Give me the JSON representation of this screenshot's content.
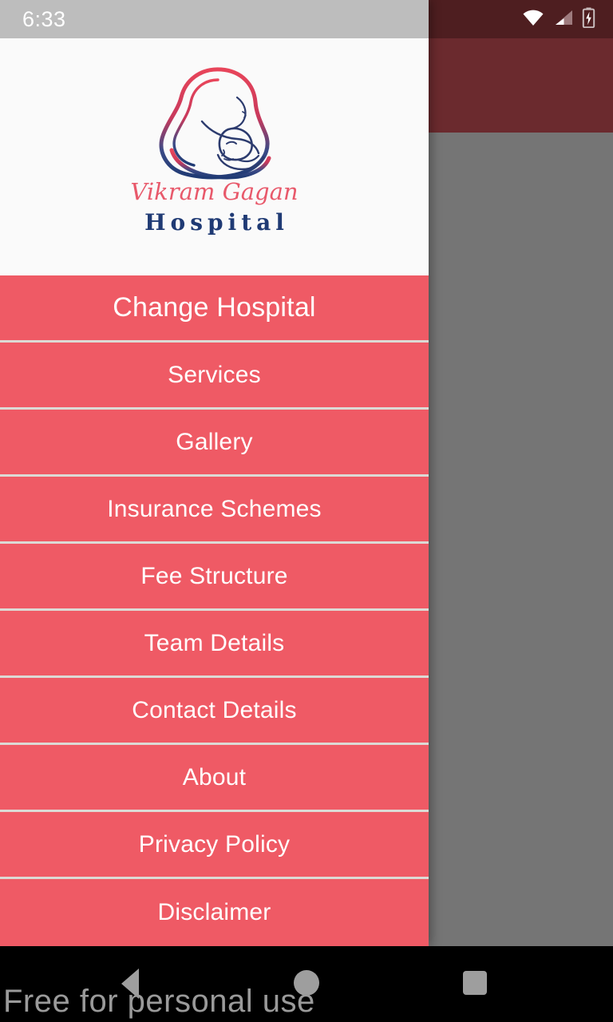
{
  "status_bar": {
    "time": "6:33",
    "icons": [
      "wifi-icon",
      "cellular-signal-icon",
      "battery-charging-icon"
    ],
    "drawer_side_bg": "#BDBDBD",
    "app_side_bg": "#4E1E20"
  },
  "app_background": {
    "appbar_color": "#6B2A2E",
    "scrim_color": "#757575"
  },
  "drawer": {
    "background_color": "#EF5A65",
    "header_background": "#FAFAFA",
    "divider_color": "#DCDAD5",
    "text_color": "#FFFFFF",
    "logo": {
      "icon_name": "mother-and-baby-logo",
      "name_line": "Vikram Gagan",
      "sub_line": "Hospital",
      "name_color": "#E8596B",
      "sub_color": "#1F3A74"
    },
    "menu_items": [
      {
        "label": "Change Hospital",
        "name": "change-hospital"
      },
      {
        "label": "Services",
        "name": "services"
      },
      {
        "label": "Gallery",
        "name": "gallery"
      },
      {
        "label": "Insurance Schemes",
        "name": "insurance-schemes"
      },
      {
        "label": "Fee Structure",
        "name": "fee-structure"
      },
      {
        "label": "Team Details",
        "name": "team-details"
      },
      {
        "label": "Contact Details",
        "name": "contact-details"
      },
      {
        "label": "About",
        "name": "about"
      },
      {
        "label": "Privacy Policy",
        "name": "privacy-policy"
      },
      {
        "label": "Disclaimer",
        "name": "disclaimer"
      }
    ]
  },
  "navigation_bar": {
    "background_color": "#000000",
    "icon_color": "#9E9E9E",
    "buttons": [
      "back-icon",
      "home-icon",
      "recents-icon"
    ]
  },
  "watermark": {
    "text": "Free for personal use",
    "color": "#9A9A9A"
  }
}
